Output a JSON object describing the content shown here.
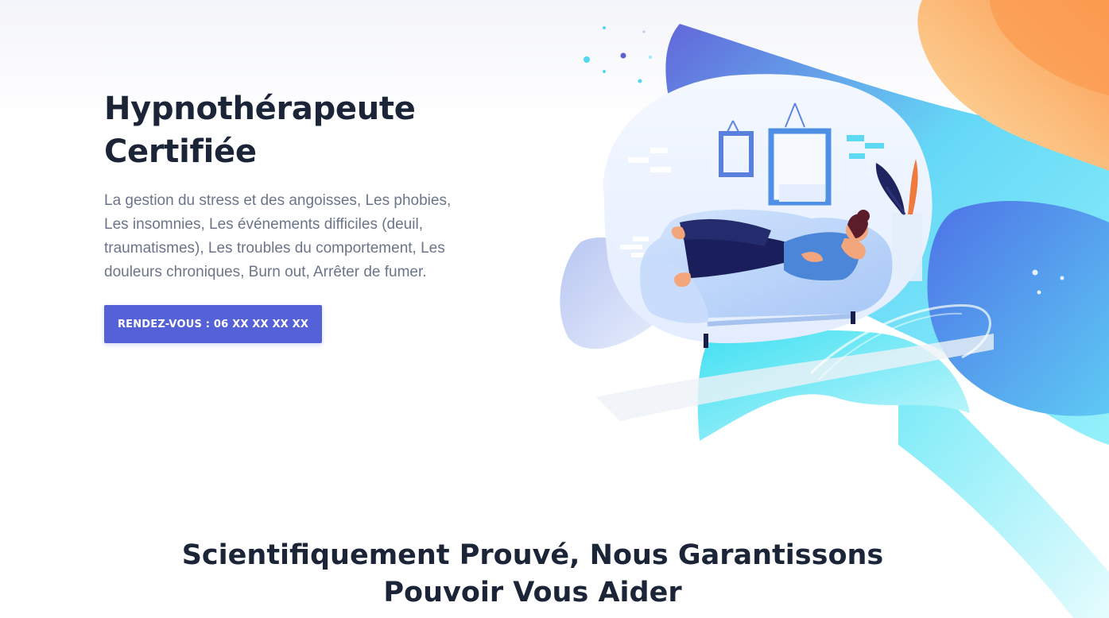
{
  "hero": {
    "title_line1": "Hypnothérapeute",
    "title_line2": "Certifiée",
    "description": "La gestion du stress et des angoisses, Les phobies, Les insomnies, Les événements difficiles (deuil, traumatismes), Les troubles du comportement, Les douleurs chroniques, Burn out, Arrêter de fumer.",
    "cta_label": "RENDEZ-VOUS : 06 XX XX XX XX",
    "illustration": "person-relaxing-on-sofa-illustration"
  },
  "section": {
    "heading_line1": "Scientifiquement Prouvé, Nous Garantissons",
    "heading_line2": "Pouvoir Vous Aider"
  },
  "colors": {
    "primary": "#5561d6",
    "heading": "#1b2537",
    "text": "#6b7589",
    "accent_cyan": "#5ee6f7",
    "accent_orange": "#fba35a"
  }
}
